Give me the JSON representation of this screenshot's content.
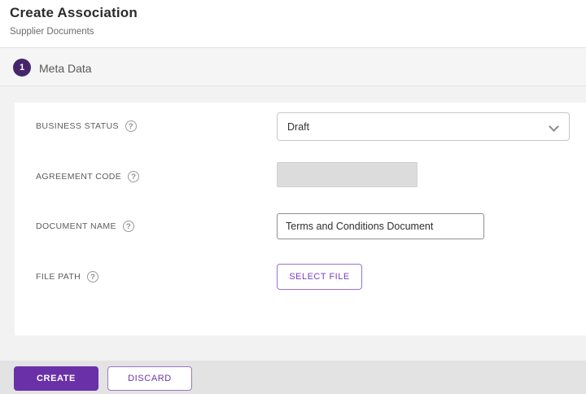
{
  "header": {
    "title": "Create Association",
    "subtitle": "Supplier Documents"
  },
  "stepper": {
    "steps": [
      {
        "number": "1",
        "label": "Meta Data"
      }
    ]
  },
  "form": {
    "business_status": {
      "label": "BUSINESS STATUS",
      "value": "Draft"
    },
    "agreement_code": {
      "label": "AGREEMENT CODE",
      "value": ""
    },
    "document_name": {
      "label": "DOCUMENT NAME",
      "value": "Terms and Conditions Document"
    },
    "file_path": {
      "label": "FILE PATH",
      "button_label": "SELECT FILE"
    }
  },
  "icons": {
    "help_glyph": "?"
  },
  "footer": {
    "create_label": "CREATE",
    "discard_label": "DISCARD"
  },
  "colors": {
    "primary_purple": "#6a30a8",
    "step_circle_purple": "#45266b",
    "outline_purple": "#9b6fd4",
    "footer_gray": "#e3e3e3",
    "disabled_input_gray": "#dcdcdc"
  }
}
